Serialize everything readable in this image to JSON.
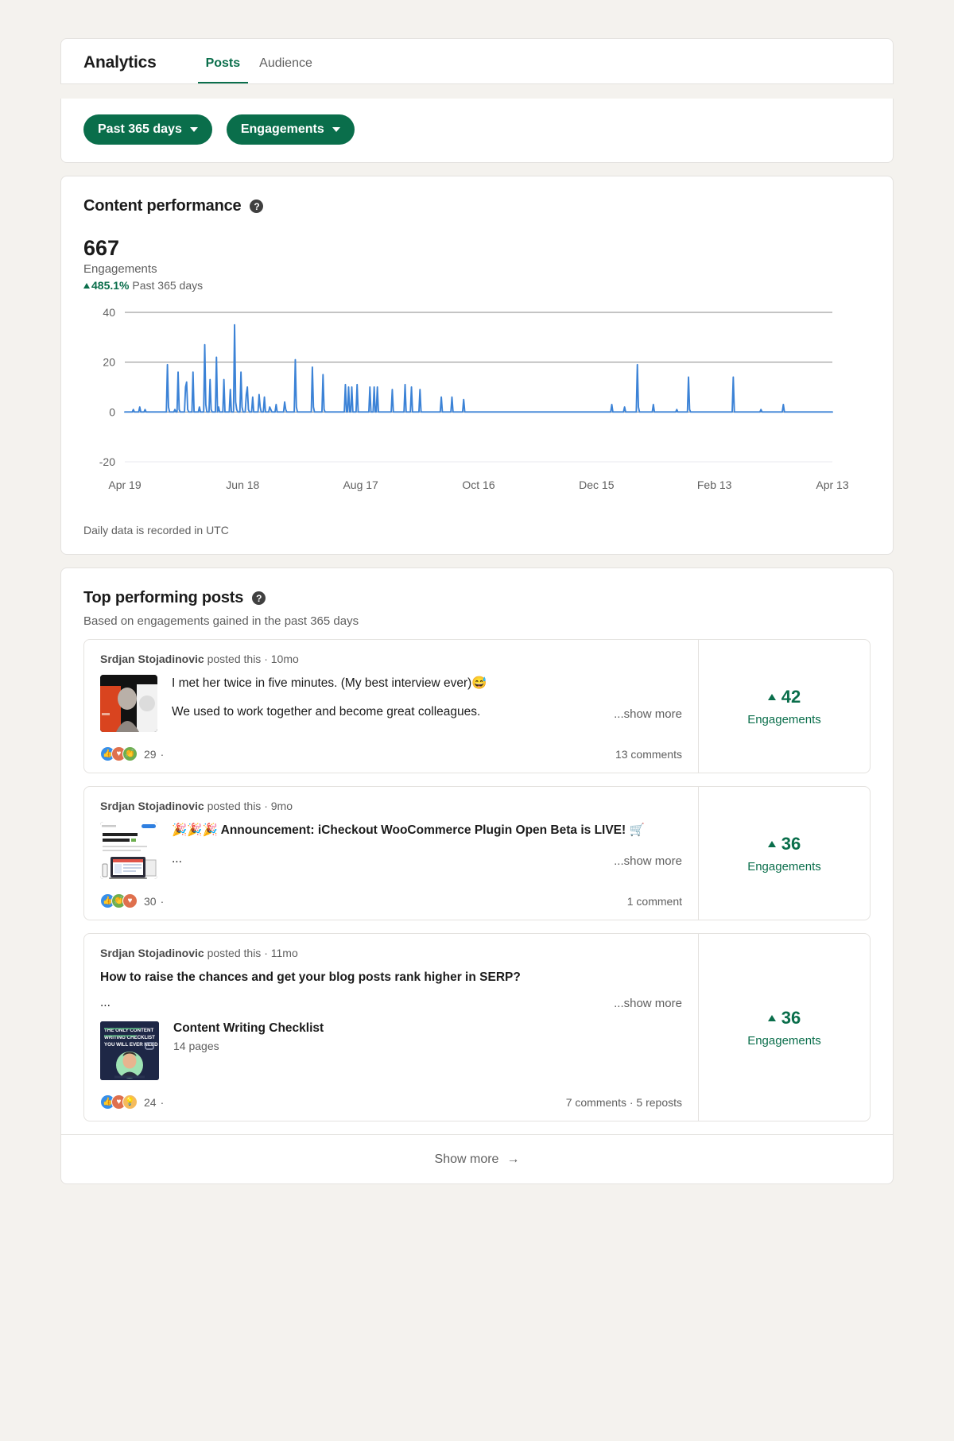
{
  "header": {
    "title": "Analytics",
    "tabs": [
      {
        "label": "Posts",
        "active": true
      },
      {
        "label": "Audience",
        "active": false
      }
    ]
  },
  "filters": {
    "date_range": "Past 365 days",
    "metric": "Engagements"
  },
  "content_performance": {
    "title": "Content performance",
    "help_glyph": "?",
    "metric_value": "667",
    "metric_label": "Engagements",
    "delta": "485.1%",
    "delta_period": "Past 365 days",
    "footnote": "Daily data is recorded in UTC"
  },
  "chart_data": {
    "type": "line",
    "title": "Content performance",
    "ylabel": "Engagements",
    "xlabel": "",
    "ylim": [
      -20,
      40
    ],
    "yticks": [
      40,
      20,
      0,
      -20
    ],
    "grid": true,
    "legend": "none",
    "line_color": "#3b82d6",
    "xticks": [
      "Apr 19",
      "Jun 18",
      "Aug 17",
      "Oct 16",
      "Dec 15",
      "Feb 13",
      "Apr 13"
    ],
    "series": [
      {
        "name": "Engagements",
        "values": [
          0,
          0,
          0,
          0,
          0,
          0,
          0,
          0,
          1,
          0,
          0,
          0,
          0,
          0,
          2,
          0,
          0,
          0,
          0,
          1,
          0,
          0,
          0,
          0,
          0,
          0,
          0,
          0,
          0,
          0,
          0,
          0,
          0,
          0,
          0,
          0,
          0,
          0,
          0,
          0,
          19,
          2,
          0,
          0,
          0,
          0,
          0,
          1,
          0,
          0,
          16,
          1,
          0,
          0,
          0,
          0,
          0,
          10,
          12,
          1,
          0,
          0,
          0,
          0,
          16,
          0,
          0,
          0,
          0,
          0,
          2,
          0,
          0,
          0,
          0,
          27,
          3,
          0,
          0,
          0,
          13,
          1,
          0,
          0,
          0,
          0,
          22,
          0,
          2,
          0,
          0,
          0,
          0,
          13,
          0,
          0,
          0,
          0,
          0,
          9,
          0,
          0,
          0,
          35,
          4,
          1,
          0,
          0,
          0,
          16,
          2,
          0,
          0,
          0,
          7,
          10,
          1,
          0,
          0,
          0,
          6,
          0,
          0,
          0,
          0,
          0,
          7,
          2,
          0,
          0,
          0,
          6,
          0,
          0,
          0,
          0,
          2,
          1,
          0,
          0,
          0,
          0,
          3,
          0,
          0,
          0,
          0,
          0,
          0,
          0,
          4,
          1,
          0,
          0,
          0,
          0,
          0,
          0,
          0,
          0,
          21,
          2,
          0,
          0,
          0,
          0,
          0,
          0,
          0,
          0,
          0,
          0,
          0,
          0,
          0,
          0,
          18,
          2,
          0,
          0,
          0,
          0,
          0,
          0,
          0,
          0,
          15,
          1,
          0,
          0,
          0,
          0,
          0,
          0,
          0,
          0,
          0,
          0,
          0,
          0,
          0,
          0,
          0,
          0,
          0,
          0,
          0,
          11,
          0,
          0,
          10,
          0,
          0,
          10,
          0,
          0,
          0,
          0,
          11,
          0,
          0,
          0,
          0,
          0,
          0,
          0,
          0,
          0,
          0,
          0,
          10,
          0,
          0,
          0,
          10,
          0,
          0,
          10,
          0,
          0,
          0,
          0,
          0,
          0,
          0,
          0,
          0,
          0,
          0,
          0,
          0,
          9,
          0,
          0,
          0,
          0,
          0,
          0,
          0,
          0,
          0,
          0,
          0,
          11,
          0,
          0,
          0,
          0,
          0,
          10,
          0,
          0,
          0,
          0,
          0,
          0,
          0,
          9,
          0,
          0,
          0,
          0,
          0,
          0,
          0,
          0,
          0,
          0,
          0,
          0,
          0,
          0,
          0,
          0,
          0,
          0,
          0,
          6,
          0,
          0,
          0,
          0,
          0,
          0,
          0,
          0,
          0,
          6,
          0,
          0,
          0,
          0,
          0,
          0,
          0,
          0,
          0,
          0,
          5,
          0,
          0,
          0,
          0,
          0,
          0,
          0,
          0,
          0,
          0,
          0,
          0,
          0,
          0,
          0,
          0,
          0,
          0,
          0,
          0,
          0,
          0,
          0,
          0,
          0,
          0,
          0,
          0,
          0,
          0,
          0,
          0,
          0,
          0,
          0,
          0,
          0,
          0,
          0,
          0,
          0,
          0,
          0,
          0,
          0,
          0,
          0,
          0,
          0,
          0,
          0,
          0,
          0,
          0,
          0,
          0,
          0,
          0,
          0,
          0,
          0,
          0,
          0,
          0,
          0,
          0,
          0,
          0,
          0,
          0,
          0,
          0,
          0,
          0,
          0,
          0,
          0,
          0,
          0,
          0,
          0,
          0,
          0,
          0,
          0,
          0,
          0,
          0,
          0,
          0,
          0,
          0,
          0,
          0,
          0,
          0,
          0,
          0,
          0,
          0,
          0,
          0,
          0,
          0,
          0,
          0,
          0,
          0,
          0,
          0,
          0,
          0,
          0,
          0,
          0,
          0,
          0,
          0,
          0,
          0,
          0,
          0,
          0,
          0,
          0,
          0,
          0,
          0,
          0,
          0,
          0,
          0,
          0,
          0,
          0,
          0,
          0,
          0,
          3,
          0,
          0,
          0,
          0,
          0,
          0,
          0,
          0,
          0,
          0,
          0,
          2,
          0,
          0,
          0,
          0,
          0,
          0,
          0,
          0,
          0,
          0,
          0,
          19,
          2,
          0,
          0,
          0,
          0,
          0,
          0,
          0,
          0,
          0,
          0,
          0,
          0,
          0,
          3,
          0,
          0,
          0,
          0,
          0,
          0,
          0,
          0,
          0,
          0,
          0,
          0,
          0,
          0,
          0,
          0,
          0,
          0,
          0,
          0,
          0,
          1,
          0,
          0,
          0,
          0,
          0,
          0,
          0,
          0,
          0,
          0,
          14,
          1,
          0,
          0,
          0,
          0,
          0,
          0,
          0,
          0,
          0,
          0,
          0,
          0,
          0,
          0,
          0,
          0,
          0,
          0,
          0,
          0,
          0,
          0,
          0,
          0,
          0,
          0,
          0,
          0,
          0,
          0,
          0,
          0,
          0,
          0,
          0,
          0,
          0,
          0,
          0,
          0,
          14,
          0,
          0,
          0,
          0,
          0,
          0,
          0,
          0,
          0,
          0,
          0,
          0,
          0,
          0,
          0,
          0,
          0,
          0,
          0,
          0,
          0,
          0,
          0,
          0,
          0,
          1,
          0,
          0,
          0,
          0,
          0,
          0,
          0,
          0,
          0,
          0,
          0,
          0,
          0,
          0,
          0,
          0,
          0,
          0,
          0,
          0,
          3,
          0,
          0,
          0,
          0,
          0,
          0,
          0,
          0,
          0,
          0,
          0,
          0,
          0,
          0,
          0,
          0,
          0,
          0,
          0,
          0,
          0,
          0,
          0,
          0,
          0,
          0,
          0,
          0,
          0,
          0,
          0,
          0,
          0,
          0,
          0,
          0,
          0,
          0,
          0,
          0,
          0,
          0,
          0,
          0,
          0,
          0
        ]
      }
    ]
  },
  "top_posts": {
    "title": "Top performing posts",
    "help_glyph": "?",
    "subtitle": "Based on engagements gained in the past 365 days",
    "show_more_label": "Show more",
    "show_more_arrow": "→",
    "posts": [
      {
        "byline_author": "Srdjan Stojadinovic",
        "byline_rest": "posted this · 10mo",
        "has_image_thumb": true,
        "thumb_kind": "photo-interview",
        "lines": [
          {
            "text": "I met her twice in five minutes. (My best interview ever)😅",
            "bold": false
          },
          {
            "text": "We used to work together and become great colleagues.",
            "bold": false
          }
        ],
        "show_more": "...show more",
        "reactions": [
          "like",
          "heart",
          "support"
        ],
        "reaction_count": "29",
        "reaction_sep": "·",
        "comments": "13 comments",
        "stat_value": "42",
        "stat_label": "Engagements"
      },
      {
        "byline_author": "Srdjan Stojadinovic",
        "byline_rest": "posted this · 9mo",
        "has_image_thumb": true,
        "thumb_kind": "plugin-promo",
        "lines": [
          {
            "text": "🎉🎉🎉 Announcement: iCheckout WooCommerce Plugin Open Beta is LIVE! 🛒",
            "bold": true
          },
          {
            "text": "...",
            "bold": false
          }
        ],
        "show_more": "...show more",
        "reactions": [
          "like",
          "support",
          "heart"
        ],
        "reaction_count": "30",
        "reaction_sep": "·",
        "comments": "1 comment",
        "stat_value": "36",
        "stat_label": "Engagements"
      },
      {
        "byline_author": "Srdjan Stojadinovic",
        "byline_rest": "posted this · 11mo",
        "has_image_thumb": false,
        "thumb_kind": "none",
        "lines": [
          {
            "text": "How to raise the chances and get your blog posts rank higher in SERP?",
            "bold": true
          },
          {
            "text": "...",
            "bold": false
          }
        ],
        "show_more": "...show more",
        "document": {
          "title": "Content Writing Checklist",
          "pages": "14 pages",
          "cover_line1": "THE ONLY CONTENT",
          "cover_line2": "WRITING CHECKLIST",
          "cover_line3": "YOU WILL EVER NEED"
        },
        "reactions": [
          "like",
          "heart",
          "insight"
        ],
        "reaction_count": "24",
        "reaction_sep": "·",
        "comments": "7 comments · 5 reposts",
        "stat_value": "36",
        "stat_label": "Engagements"
      }
    ]
  },
  "colors": {
    "brand_green": "#0a6e4b",
    "chart_line": "#3b82d6",
    "page_bg": "#f4f2ee",
    "card_bg": "#ffffff",
    "border": "#e4e2df"
  }
}
